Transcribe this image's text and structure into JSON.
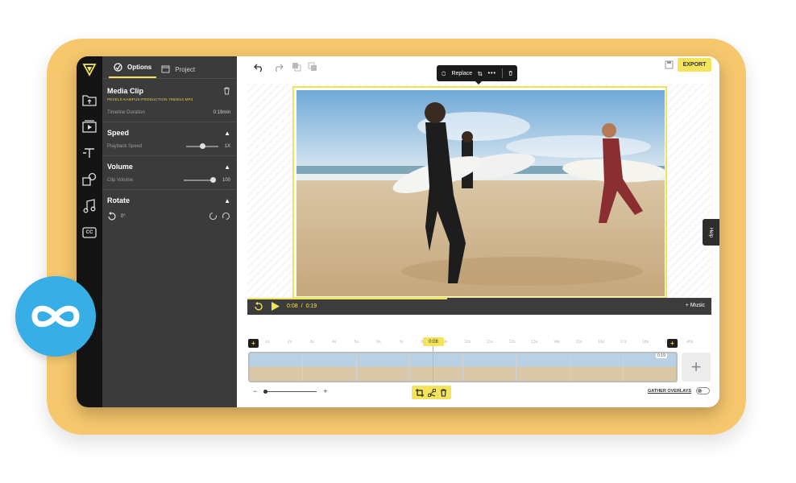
{
  "panel": {
    "tabs": [
      {
        "label": "Options",
        "icon": "options-icon",
        "active": true
      },
      {
        "label": "Project",
        "icon": "clapperboard-icon",
        "active": false
      }
    ],
    "media_clip": {
      "title": "Media Clip",
      "filename": "PEXELS-KAMPUS-PRODUCTION-7660610.MP4",
      "duration_label": "Timeline Duration",
      "duration_value": "0:19min"
    },
    "speed": {
      "title": "Speed",
      "label": "Playback Speed",
      "value": "1X",
      "level": 0.55
    },
    "volume": {
      "title": "Volume",
      "label": "Clip Volume",
      "value": "100",
      "level": 1.0
    },
    "rotate": {
      "title": "Rotate",
      "value": "0°"
    }
  },
  "rail": {
    "icons": [
      "logo-icon",
      "upload-folder-icon",
      "media-icon",
      "text-icon",
      "elements-icon",
      "music-icon",
      "subtitles-icon"
    ],
    "subtitles_label": "CC"
  },
  "toolbar": {
    "replace_label": "Replace",
    "export_label": "EXPORT"
  },
  "player": {
    "current_time": "0:08",
    "total_time": "0:19",
    "separator": "/",
    "progress": 0.43,
    "music_label": "+ Music"
  },
  "help_label": "Help",
  "timeline": {
    "ticks": [
      "1s",
      "2s",
      "3s",
      "4s",
      "5s",
      "6s",
      "7s",
      "8s",
      "9s",
      "10s",
      "11s",
      "12s",
      "13s",
      "14s",
      "15s",
      "16s",
      "17s",
      "18s",
      "19s",
      "20s"
    ],
    "playhead_label": "0:08",
    "clip_badge": "0:19",
    "marker_plus": "+",
    "add_clip_label": "+",
    "zoom_minus": "−",
    "zoom_plus": "+",
    "zoom_level": 0.0,
    "gather_overlays_label": "GATHER OVERLAYS"
  },
  "colors": {
    "accent": "#f4e45c",
    "panel_bg": "#3b3b3b",
    "rail_bg": "#141414",
    "frame_bg": "#f6c76d",
    "badge_blue": "#37aee6"
  }
}
